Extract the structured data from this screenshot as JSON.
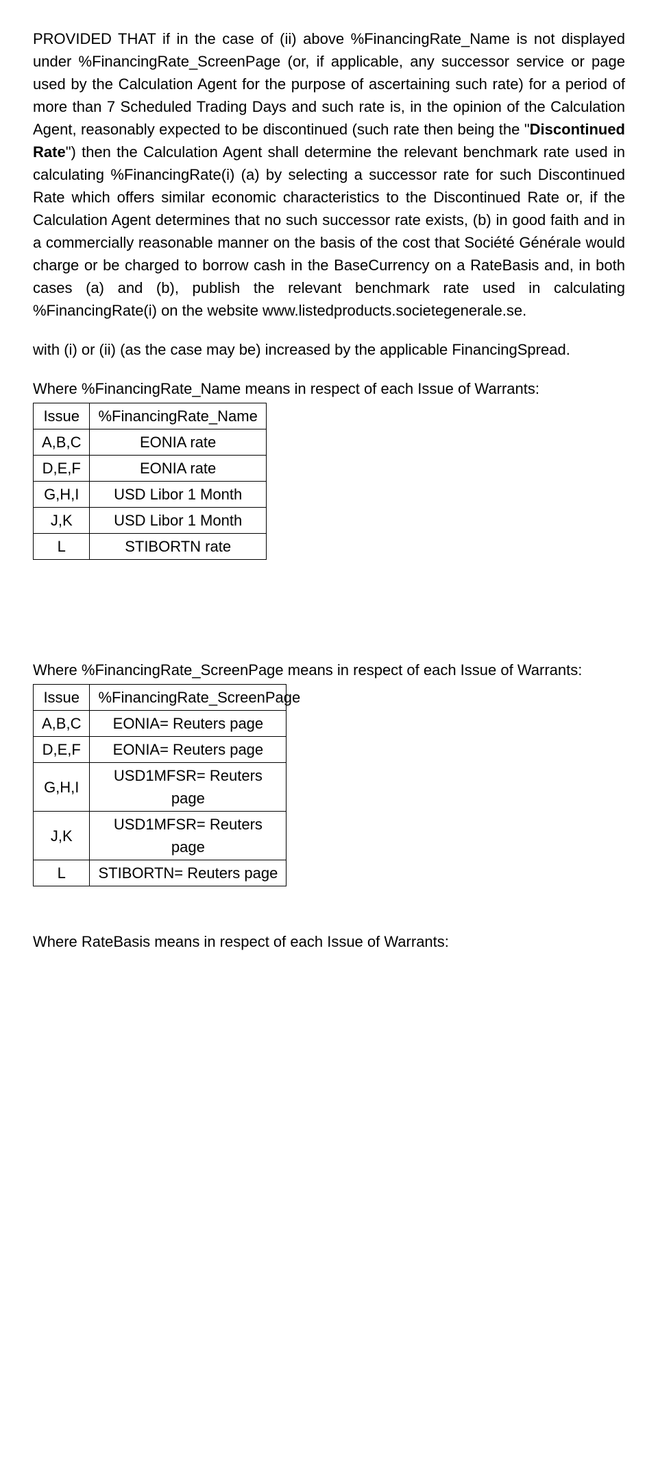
{
  "p1_part1": "PROVIDED THAT if in the case of (ii) above %FinancingRate_Name is not displayed under %FinancingRate_ScreenPage (or, if applicable, any successor service or page used by the Calculation Agent for the purpose of ascertaining such rate) for a period of more than 7 Scheduled Trading Days and such rate is, in the opinion of the Calculation Agent, reasonably expected to be discontinued (such rate then being the \"",
  "p1_bold": "Discontinued Rate",
  "p1_part2": "\") then the Calculation Agent shall determine the relevant benchmark rate used in calculating %FinancingRate(i) (a) by selecting a successor rate for such Discontinued Rate which offers similar economic characteristics to the Discontinued Rate or, if the Calculation Agent determines that no such successor rate exists, (b) in good faith and in a commercially reasonable manner on the basis of the cost that Société Générale would charge or be charged to borrow cash in the BaseCurrency on a RateBasis and, in both cases (a) and (b), publish the relevant benchmark rate used in calculating %FinancingRate(i) on the website www.listedproducts.societegenerale.se.",
  "p2": "with (i) or (ii) (as the case may be) increased by the applicable FinancingSpread.",
  "p3": "Where %FinancingRate_Name means in respect of each Issue of Warrants:",
  "table1": {
    "h0": "Issue",
    "h1": "%FinancingRate_Name",
    "rows": [
      {
        "c0": "A,B,C",
        "c1": "EONIA rate"
      },
      {
        "c0": "D,E,F",
        "c1": "EONIA rate"
      },
      {
        "c0": "G,H,I",
        "c1": "USD Libor 1 Month"
      },
      {
        "c0": "J,K",
        "c1": "USD Libor 1 Month"
      },
      {
        "c0": "L",
        "c1": "STIBORTN rate"
      }
    ]
  },
  "p4": "Where %FinancingRate_ScreenPage means in respect of each Issue of Warrants:",
  "table2": {
    "h0": "Issue",
    "h1": "%FinancingRate_ScreenPage",
    "rows": [
      {
        "c0": "A,B,C",
        "c1": "EONIA= Reuters page"
      },
      {
        "c0": "D,E,F",
        "c1": "EONIA= Reuters page"
      },
      {
        "c0": "G,H,I",
        "c1": "USD1MFSR= Reuters page"
      },
      {
        "c0": "J,K",
        "c1": "USD1MFSR= Reuters page"
      },
      {
        "c0": "L",
        "c1": "STIBORTN= Reuters page"
      }
    ]
  },
  "p5": "Where RateBasis means in respect of each Issue of Warrants:"
}
